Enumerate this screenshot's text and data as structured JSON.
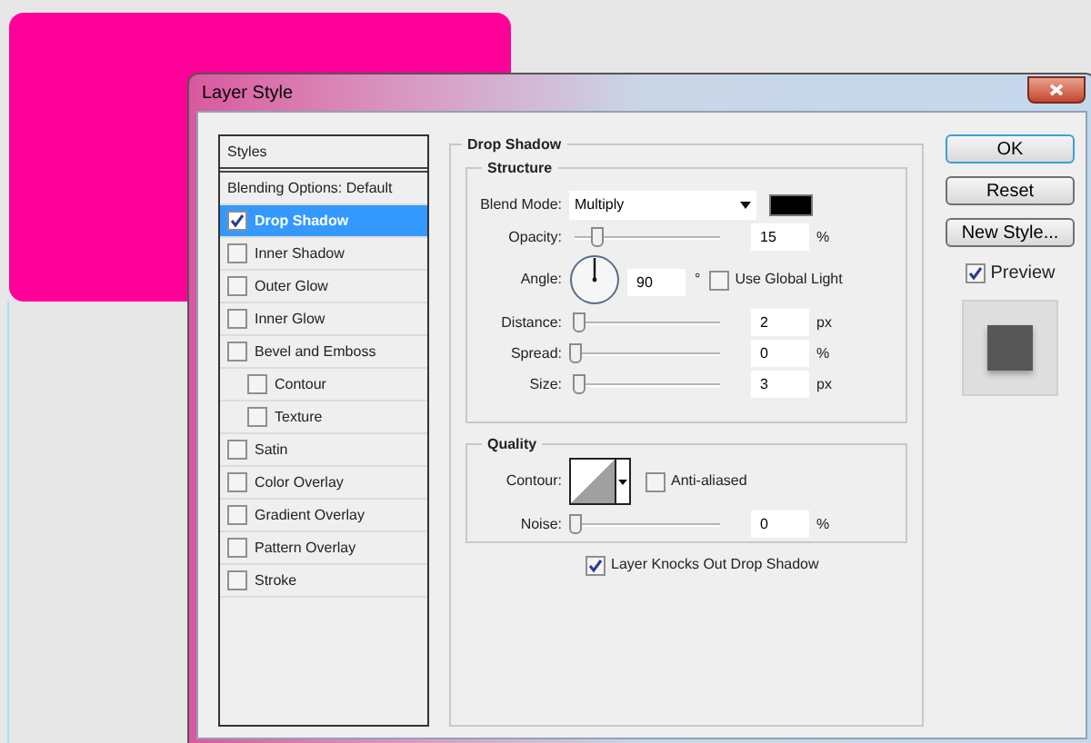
{
  "window": {
    "title": "Layer Style"
  },
  "styles_panel": {
    "header": "Styles",
    "items": [
      {
        "label": "Blending Options: Default",
        "kind": "heading",
        "selected": false
      },
      {
        "label": "Drop Shadow",
        "kind": "effect",
        "checked": true,
        "selected": true
      },
      {
        "label": "Inner Shadow",
        "kind": "effect",
        "checked": false,
        "selected": false
      },
      {
        "label": "Outer Glow",
        "kind": "effect",
        "checked": false,
        "selected": false
      },
      {
        "label": "Inner Glow",
        "kind": "effect",
        "checked": false,
        "selected": false
      },
      {
        "label": "Bevel and Emboss",
        "kind": "effect",
        "checked": false,
        "selected": false,
        "children": [
          {
            "label": "Contour",
            "kind": "effect",
            "checked": false,
            "selected": false
          },
          {
            "label": "Texture",
            "kind": "effect",
            "checked": false,
            "selected": false
          }
        ]
      },
      {
        "label": "Satin",
        "kind": "effect",
        "checked": false,
        "selected": false
      },
      {
        "label": "Color Overlay",
        "kind": "effect",
        "checked": false,
        "selected": false
      },
      {
        "label": "Gradient Overlay",
        "kind": "effect",
        "checked": false,
        "selected": false
      },
      {
        "label": "Pattern Overlay",
        "kind": "effect",
        "checked": false,
        "selected": false
      },
      {
        "label": "Stroke",
        "kind": "effect",
        "checked": false,
        "selected": false
      }
    ]
  },
  "drop_shadow": {
    "title": "Drop Shadow",
    "structure": {
      "title": "Structure",
      "blend_mode": {
        "label": "Blend Mode:",
        "value": "Multiply"
      },
      "opacity": {
        "label": "Opacity:",
        "level": 0.15,
        "value": "15",
        "unit": "%"
      },
      "angle": {
        "label": "Angle:",
        "value": "90",
        "unit": "°"
      },
      "use_global_light": {
        "label": "Use Global Light",
        "checked": false
      },
      "sliders": [
        {
          "label": "Distance:",
          "level": 0.02,
          "value": "2",
          "unit": "px"
        },
        {
          "label": "Spread:",
          "level": 0,
          "value": "0",
          "unit": "%"
        },
        {
          "label": "Size:",
          "level": 0.03,
          "value": "3",
          "unit": "px"
        }
      ]
    },
    "quality": {
      "title": "Quality",
      "contour": {
        "label": "Contour:"
      },
      "anti_aliased": {
        "label": "Anti-aliased",
        "checked": false
      },
      "noise": {
        "label": "Noise:",
        "level": 0,
        "value": "0",
        "unit": "%"
      }
    },
    "knockout": {
      "label": "Layer Knocks Out Drop Shadow",
      "checked": true
    }
  },
  "buttons": [
    {
      "label": "OK",
      "selected": true
    },
    {
      "label": "Reset",
      "selected": false
    },
    {
      "label": "New Style...",
      "selected": false
    }
  ],
  "preview": {
    "label": "Preview",
    "checked": true
  }
}
